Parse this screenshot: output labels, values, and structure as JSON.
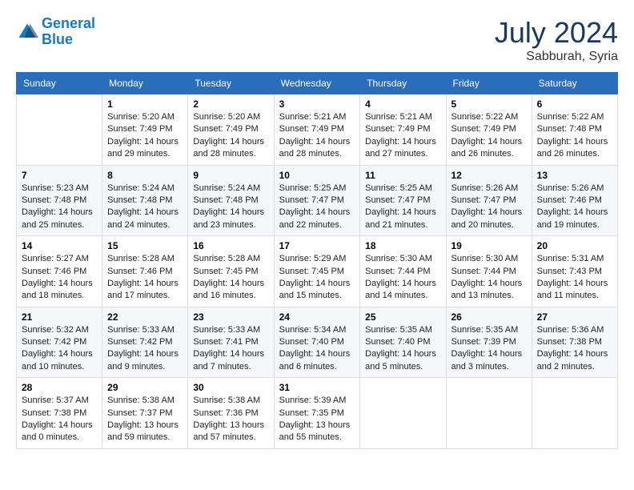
{
  "header": {
    "logo_line1": "General",
    "logo_line2": "Blue",
    "month_year": "July 2024",
    "location": "Sabburah, Syria"
  },
  "weekdays": [
    "Sunday",
    "Monday",
    "Tuesday",
    "Wednesday",
    "Thursday",
    "Friday",
    "Saturday"
  ],
  "weeks": [
    [
      {
        "day": null,
        "info": null
      },
      {
        "day": "1",
        "sunrise": "5:20 AM",
        "sunset": "7:49 PM",
        "daylight": "14 hours and 29 minutes."
      },
      {
        "day": "2",
        "sunrise": "5:20 AM",
        "sunset": "7:49 PM",
        "daylight": "14 hours and 28 minutes."
      },
      {
        "day": "3",
        "sunrise": "5:21 AM",
        "sunset": "7:49 PM",
        "daylight": "14 hours and 28 minutes."
      },
      {
        "day": "4",
        "sunrise": "5:21 AM",
        "sunset": "7:49 PM",
        "daylight": "14 hours and 27 minutes."
      },
      {
        "day": "5",
        "sunrise": "5:22 AM",
        "sunset": "7:49 PM",
        "daylight": "14 hours and 26 minutes."
      },
      {
        "day": "6",
        "sunrise": "5:22 AM",
        "sunset": "7:48 PM",
        "daylight": "14 hours and 26 minutes."
      }
    ],
    [
      {
        "day": "7",
        "sunrise": "5:23 AM",
        "sunset": "7:48 PM",
        "daylight": "14 hours and 25 minutes."
      },
      {
        "day": "8",
        "sunrise": "5:24 AM",
        "sunset": "7:48 PM",
        "daylight": "14 hours and 24 minutes."
      },
      {
        "day": "9",
        "sunrise": "5:24 AM",
        "sunset": "7:48 PM",
        "daylight": "14 hours and 23 minutes."
      },
      {
        "day": "10",
        "sunrise": "5:25 AM",
        "sunset": "7:47 PM",
        "daylight": "14 hours and 22 minutes."
      },
      {
        "day": "11",
        "sunrise": "5:25 AM",
        "sunset": "7:47 PM",
        "daylight": "14 hours and 21 minutes."
      },
      {
        "day": "12",
        "sunrise": "5:26 AM",
        "sunset": "7:47 PM",
        "daylight": "14 hours and 20 minutes."
      },
      {
        "day": "13",
        "sunrise": "5:26 AM",
        "sunset": "7:46 PM",
        "daylight": "14 hours and 19 minutes."
      }
    ],
    [
      {
        "day": "14",
        "sunrise": "5:27 AM",
        "sunset": "7:46 PM",
        "daylight": "14 hours and 18 minutes."
      },
      {
        "day": "15",
        "sunrise": "5:28 AM",
        "sunset": "7:46 PM",
        "daylight": "14 hours and 17 minutes."
      },
      {
        "day": "16",
        "sunrise": "5:28 AM",
        "sunset": "7:45 PM",
        "daylight": "14 hours and 16 minutes."
      },
      {
        "day": "17",
        "sunrise": "5:29 AM",
        "sunset": "7:45 PM",
        "daylight": "14 hours and 15 minutes."
      },
      {
        "day": "18",
        "sunrise": "5:30 AM",
        "sunset": "7:44 PM",
        "daylight": "14 hours and 14 minutes."
      },
      {
        "day": "19",
        "sunrise": "5:30 AM",
        "sunset": "7:44 PM",
        "daylight": "14 hours and 13 minutes."
      },
      {
        "day": "20",
        "sunrise": "5:31 AM",
        "sunset": "7:43 PM",
        "daylight": "14 hours and 11 minutes."
      }
    ],
    [
      {
        "day": "21",
        "sunrise": "5:32 AM",
        "sunset": "7:42 PM",
        "daylight": "14 hours and 10 minutes."
      },
      {
        "day": "22",
        "sunrise": "5:33 AM",
        "sunset": "7:42 PM",
        "daylight": "14 hours and 9 minutes."
      },
      {
        "day": "23",
        "sunrise": "5:33 AM",
        "sunset": "7:41 PM",
        "daylight": "14 hours and 7 minutes."
      },
      {
        "day": "24",
        "sunrise": "5:34 AM",
        "sunset": "7:40 PM",
        "daylight": "14 hours and 6 minutes."
      },
      {
        "day": "25",
        "sunrise": "5:35 AM",
        "sunset": "7:40 PM",
        "daylight": "14 hours and 5 minutes."
      },
      {
        "day": "26",
        "sunrise": "5:35 AM",
        "sunset": "7:39 PM",
        "daylight": "14 hours and 3 minutes."
      },
      {
        "day": "27",
        "sunrise": "5:36 AM",
        "sunset": "7:38 PM",
        "daylight": "14 hours and 2 minutes."
      }
    ],
    [
      {
        "day": "28",
        "sunrise": "5:37 AM",
        "sunset": "7:38 PM",
        "daylight": "14 hours and 0 minutes."
      },
      {
        "day": "29",
        "sunrise": "5:38 AM",
        "sunset": "7:37 PM",
        "daylight": "13 hours and 59 minutes."
      },
      {
        "day": "30",
        "sunrise": "5:38 AM",
        "sunset": "7:36 PM",
        "daylight": "13 hours and 57 minutes."
      },
      {
        "day": "31",
        "sunrise": "5:39 AM",
        "sunset": "7:35 PM",
        "daylight": "13 hours and 55 minutes."
      },
      {
        "day": null,
        "info": null
      },
      {
        "day": null,
        "info": null
      },
      {
        "day": null,
        "info": null
      }
    ]
  ]
}
